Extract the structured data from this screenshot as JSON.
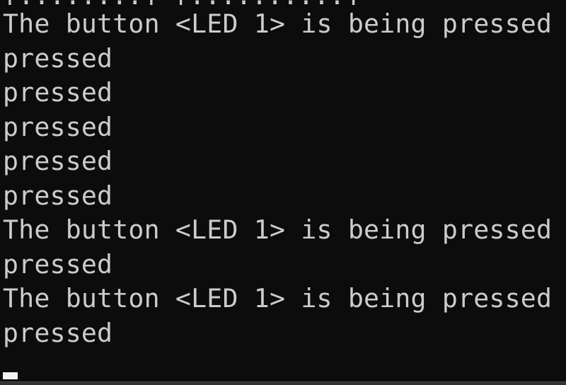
{
  "console": {
    "partial_top_line": "[........] [..........]",
    "lines": [
      "The button <LED 1> is being pressed",
      "pressed",
      "pressed",
      "pressed",
      "pressed",
      "pressed",
      "The button <LED 1> is being pressed",
      "pressed",
      "The button <LED 1> is being pressed",
      "pressed"
    ]
  },
  "colors": {
    "background": "#0c0c0c",
    "text": "#cccccc",
    "cursor": "#f2f2f2"
  }
}
